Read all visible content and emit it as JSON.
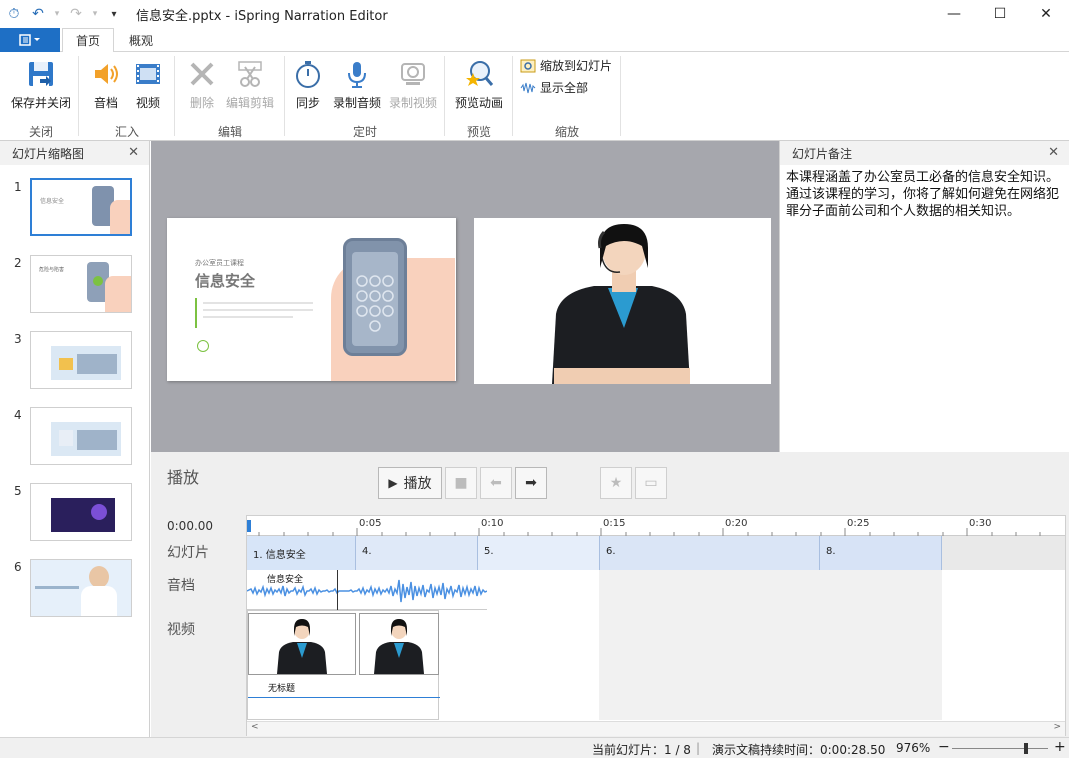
{
  "window": {
    "title": "信息安全.pptx - iSpring Narration Editor",
    "min_glyph": "—",
    "max_glyph": "☐",
    "close_glyph": "✕"
  },
  "tabs": {
    "file_icon": "menu-icon",
    "items": [
      {
        "label": "首页",
        "active": true
      },
      {
        "label": "概观",
        "active": false
      }
    ]
  },
  "ribbon": {
    "save_close": "保存并关闭",
    "audio": "音档",
    "video": "视频",
    "delete": "删除",
    "edit_clip": "编辑剪辑",
    "sync": "同步",
    "record_audio": "录制音频",
    "record_video": "录制视频",
    "preview_animation": "预览动画",
    "zoom_to_slide": "缩放到幻灯片",
    "show_all": "显示全部",
    "groups": {
      "close": "关闭",
      "import": "汇入",
      "edit": "编辑",
      "timing": "定时",
      "preview": "预览",
      "zoom": "缩放"
    }
  },
  "thumbnails": {
    "title": "幻灯片缩略图",
    "items": [
      {
        "num": "1",
        "caption": "信息安全"
      },
      {
        "num": "2",
        "caption": "危险与陷害"
      },
      {
        "num": "3",
        "caption": ""
      },
      {
        "num": "4",
        "caption": ""
      },
      {
        "num": "5",
        "caption": ""
      },
      {
        "num": "6",
        "caption": ""
      }
    ]
  },
  "slide": {
    "subtitle": "办公室员工课程",
    "title": "信息安全"
  },
  "notes": {
    "title": "幻灯片备注",
    "text": "本课程涵盖了办公室员工必备的信息安全知识。通过该课程的学习，你将了解如何避免在网络犯罪分子面前公司和个人数据的相关知识。"
  },
  "playback": {
    "title": "播放",
    "play": "播放",
    "current_time": "0:00.00",
    "rows": {
      "slides": "幻灯片",
      "audio": "音档",
      "video": "视频"
    },
    "ticks": [
      "0:05",
      "0:10",
      "0:15",
      "0:20",
      "0:25",
      "0:30"
    ],
    "segments": [
      "1. 信息安全",
      "4.",
      "5.",
      "6.",
      "8."
    ],
    "audio_clip": "信息安全",
    "video_clip": "无标题"
  },
  "status": {
    "current_slide": "当前幻灯片：1 / 8",
    "duration": "演示文稿持续时间：0:00:28.50",
    "zoom": "976%",
    "minus": "−",
    "plus": "+"
  },
  "colors": {
    "accent": "#1e6fc5",
    "stage": "#a6a7ad",
    "segment": "#dfe9f8",
    "wave": "#4a90e2"
  }
}
